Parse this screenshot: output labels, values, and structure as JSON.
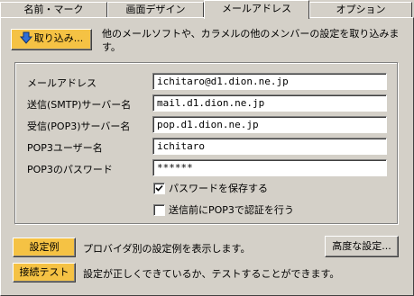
{
  "tabs": [
    {
      "label": "名前・マーク"
    },
    {
      "label": "画面デザイン"
    },
    {
      "label": "メールアドレス"
    },
    {
      "label": "オプション"
    }
  ],
  "active_tab": "メールアドレス",
  "import": {
    "button_label": "取り込み...",
    "description": "他のメールソフトや、カラメルの他のメンバーの設定を取り込みます。"
  },
  "form": {
    "email": {
      "label": "メールアドレス",
      "value": "ichitaro@d1.dion.ne.jp"
    },
    "smtp": {
      "label": "送信(SMTP)サーバー名",
      "value": "mail.d1.dion.ne.jp"
    },
    "pop3": {
      "label": "受信(POP3)サーバー名",
      "value": "pop.d1.dion.ne.jp"
    },
    "pop3_user": {
      "label": "POP3ユーザー名",
      "value": "ichitaro"
    },
    "pop3_password": {
      "label": "POP3のパスワード",
      "value": "******"
    },
    "save_password": {
      "label": "パスワードを保存する",
      "checked": true
    },
    "pop_before_smtp": {
      "label": "送信前にPOP3で認証を行う",
      "checked": false
    }
  },
  "example": {
    "button_label": "設定例",
    "description": "プロバイダ別の設定例を表示します。"
  },
  "advanced": {
    "button_label": "高度な設定..."
  },
  "test": {
    "button_label": "接続テスト",
    "description": "設定が正しくできているか、テストすることができます。"
  },
  "colors": {
    "accent_button": "#f5c244",
    "background": "#d4d0c8"
  }
}
